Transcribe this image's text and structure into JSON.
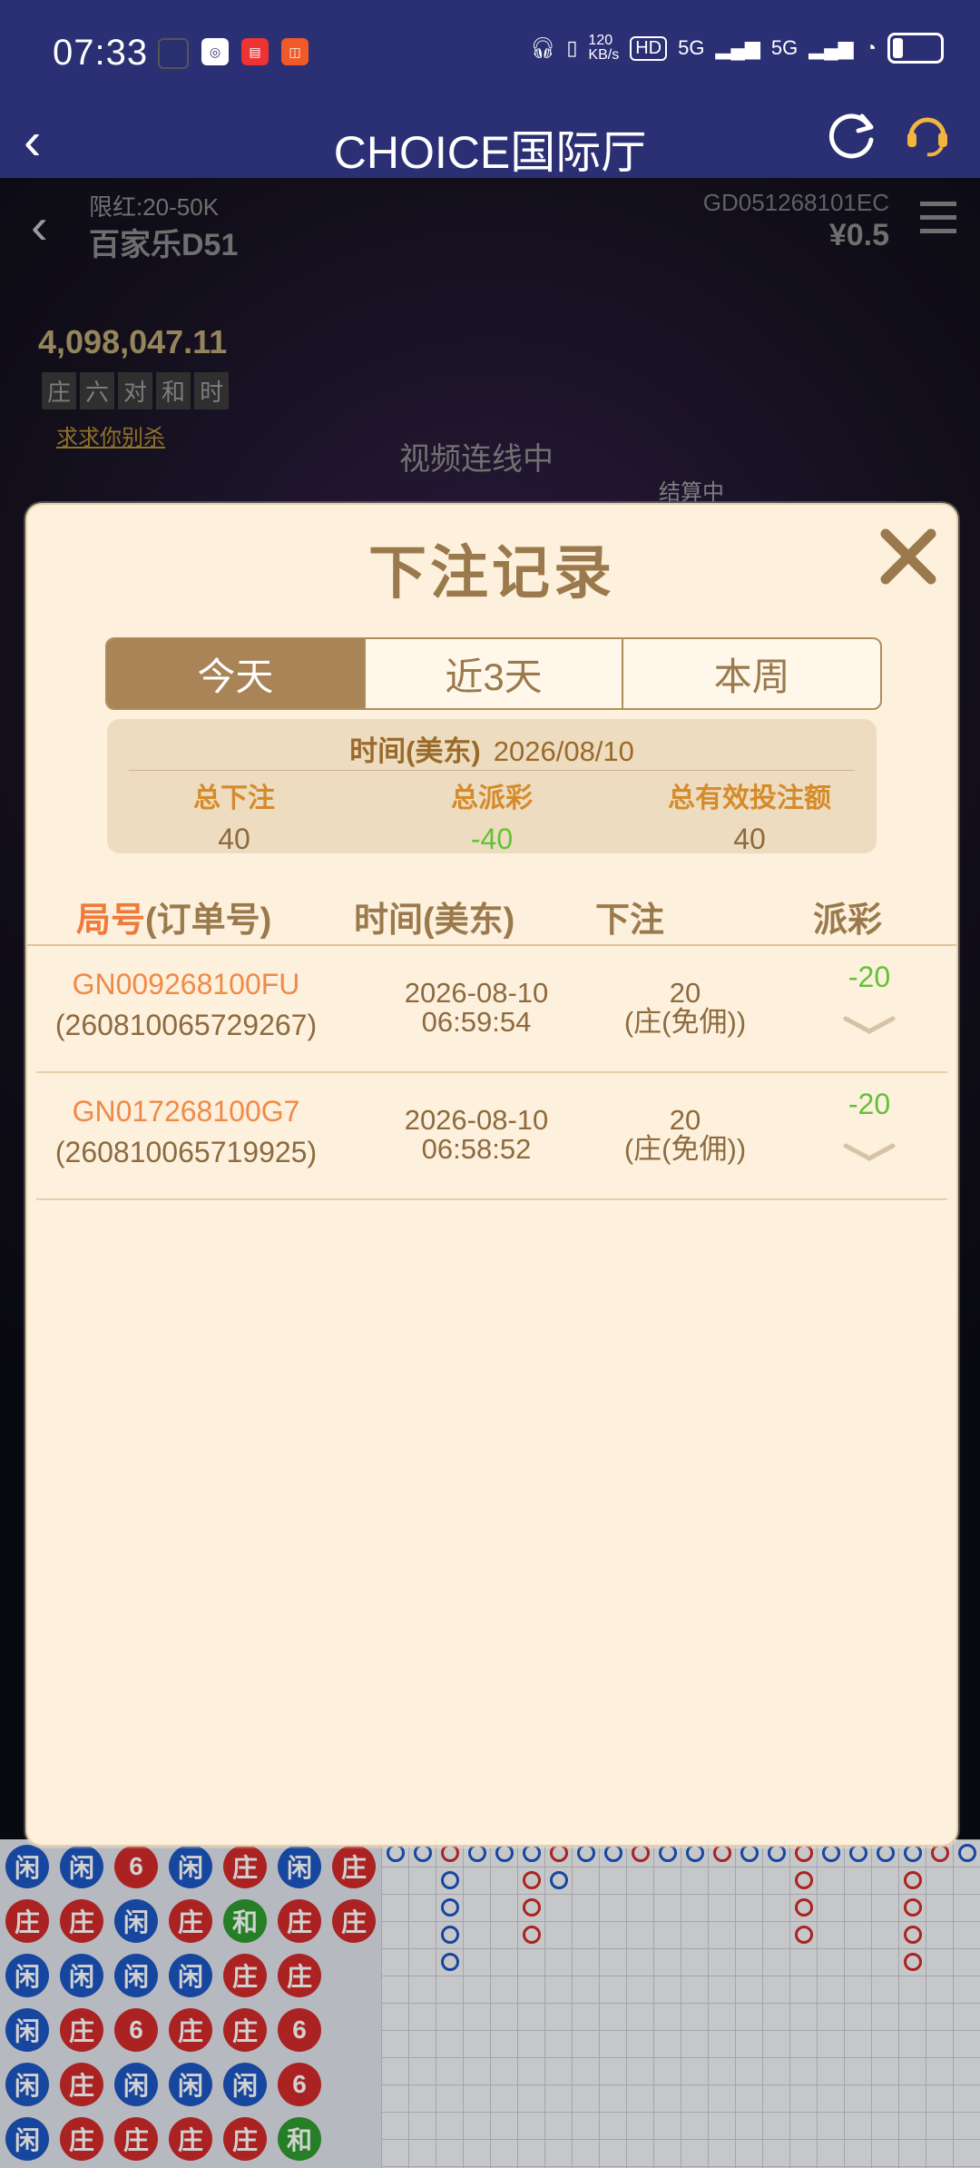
{
  "status_bar": {
    "time": "07:33",
    "network_speed": "120\nKB/s",
    "signal_1": "5G",
    "signal_2": "5G",
    "hd": "HD"
  },
  "app_header": {
    "title": "CHOICE国际厅"
  },
  "game_background": {
    "limit": "限红:20-50K",
    "table_name": "百家乐D51",
    "game_id": "GD051268101EC",
    "balance": "¥0.5",
    "jackpot": "4,098,047.11",
    "jackpot_tags": [
      "庄",
      "六",
      "对",
      "和",
      "时"
    ],
    "hint": "求求你别杀",
    "connecting": "视频连线中",
    "settling": "结算中"
  },
  "modal": {
    "title": "下注记录",
    "tabs": [
      {
        "label": "今天",
        "active": true
      },
      {
        "label": "近3天",
        "active": false
      },
      {
        "label": "本周",
        "active": false
      }
    ],
    "summary": {
      "time_label": "时间(美东)",
      "date": "2026/08/10",
      "total_bet_label": "总下注",
      "total_bet": "40",
      "total_payout_label": "总派彩",
      "total_payout": "-40",
      "total_valid_label": "总有效投注额",
      "total_valid": "40"
    },
    "columns": {
      "round_hl": "局号",
      "round_rest": "(订单号)",
      "time": "时间(美东)",
      "bet": "下注",
      "payout": "派彩"
    },
    "rows": [
      {
        "round": "GN009268100FU",
        "order": "(260810065729267)",
        "date": "2026-08-10",
        "time": "06:59:54",
        "bet": "20",
        "bet_type": "(庄(免佣))",
        "payout": "-20"
      },
      {
        "round": "GN017268100G7",
        "order": "(260810065719925)",
        "date": "2026-08-10",
        "time": "06:58:52",
        "bet": "20",
        "bet_type": "(庄(免佣))",
        "payout": "-20"
      }
    ]
  },
  "board": {
    "bead_rows": [
      [
        "闲",
        "闲",
        "6",
        "闲",
        "庄",
        "闲",
        "庄"
      ],
      [
        "庄",
        "庄",
        "闲",
        "庄",
        "和",
        "庄",
        "庄"
      ],
      [
        "闲",
        "闲",
        "闲",
        "闲",
        "庄",
        "庄",
        ""
      ],
      [
        "闲",
        "庄",
        "6",
        "庄",
        "庄",
        "6",
        ""
      ],
      [
        "闲",
        "庄",
        "闲",
        "闲",
        "闲",
        "6",
        ""
      ],
      [
        "闲",
        "庄",
        "庄",
        "庄",
        "庄",
        "和",
        ""
      ]
    ]
  },
  "colors": {
    "header_bg": "#2b2f73",
    "modal_bg": "#fdf0dc",
    "accent_brown": "#a98456",
    "orange": "#ef8a4a",
    "green": "#62c236"
  }
}
